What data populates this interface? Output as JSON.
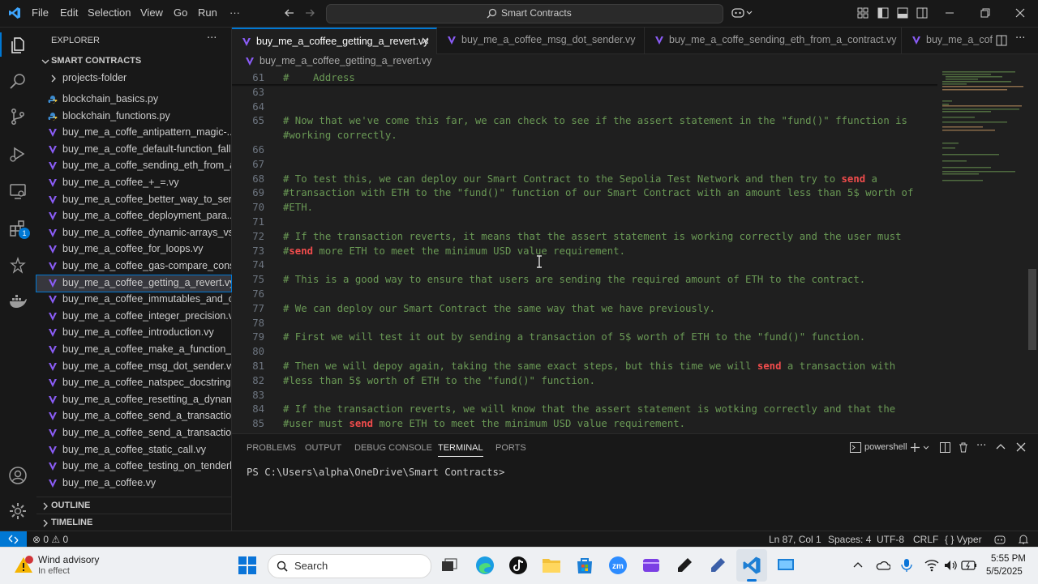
{
  "titlebar": {
    "menu": [
      "File",
      "Edit",
      "Selection",
      "View",
      "Go",
      "Run",
      "···"
    ],
    "search_text": "Smart Contracts"
  },
  "sidebar": {
    "title": "EXPLORER",
    "more": "···",
    "workspace": "SMART CONTRACTS",
    "folder": "projects-folder",
    "files": [
      "blockchain_basics.py",
      "blockchain_functions.py",
      "buy_me_a_coffe_antipattern_magic-...",
      "buy_me_a_coffe_default-function_fall...",
      "buy_me_a_coffe_sending_eth_from_a...",
      "buy_me_a_coffee_+_=.vy",
      "buy_me_a_coffee_better_way_to_sen...",
      "buy_me_a_coffee_deployment_para...",
      "buy_me_a_coffee_dynamic-arrays_vs...",
      "buy_me_a_coffee_for_loops.vy",
      "buy_me_a_coffee_gas-compare_cons...",
      "buy_me_a_coffee_getting_a_revert.vy",
      "buy_me_a_coffee_immutables_and_c...",
      "buy_me_a_coffee_integer_precision.vy",
      "buy_me_a_coffee_introduction.vy",
      "buy_me_a_coffee_make_a_function_c...",
      "buy_me_a_coffee_msg_dot_sender.vy",
      "buy_me_a_coffee_natspec_docstring...",
      "buy_me_a_coffee_resetting_a_dynam...",
      "buy_me_a_coffee_send_a_transaction...",
      "buy_me_a_coffee_send_a_transaction...",
      "buy_me_a_coffee_static_call.vy",
      "buy_me_a_coffee_testing_on_tenderl...",
      "buy_me_a_coffee.vy"
    ],
    "outline": "OUTLINE",
    "timeline": "TIMELINE",
    "extensions_badge": "1"
  },
  "tabs": [
    {
      "label": "buy_me_a_coffee_getting_a_revert.vy",
      "close": "✕"
    },
    {
      "label": "buy_me_a_coffee_msg_dot_sender.vy"
    },
    {
      "label": "buy_me_a_coffe_sending_eth_from_a_contract.vy"
    },
    {
      "label": "buy_me_a_coff"
    }
  ],
  "breadcrumb": "buy_me_a_coffee_getting_a_revert.vy",
  "editor": {
    "lines": [
      {
        "n": "61",
        "text": "#    Address"
      },
      {
        "n": "63",
        "text": ""
      },
      {
        "n": "64",
        "text": ""
      },
      {
        "n": "65",
        "text": "# Now that we've come this far, we can check to see if the assert statement in the \"fund()\" ffunction is"
      },
      {
        "n": "",
        "text": "#working correctly."
      },
      {
        "n": "66",
        "text": ""
      },
      {
        "n": "67",
        "text": ""
      },
      {
        "n": "68",
        "pre": "# To test this, we can deploy our Smart Contract to the Sepolia Test Network and then try to ",
        "kw": "send",
        "post": " a"
      },
      {
        "n": "69",
        "text": "#transaction with ETH to the \"fund()\" function of our Smart Contract with an amount less than 5$ worth of"
      },
      {
        "n": "70",
        "text": "#ETH."
      },
      {
        "n": "71",
        "text": ""
      },
      {
        "n": "72",
        "text": "# If the transaction reverts, it means that the assert statement is working correctly and the user must"
      },
      {
        "n": "73",
        "pre": "#",
        "kw": "send",
        "post": " more ETH to meet the minimum USD value requirement."
      },
      {
        "n": "74",
        "text": ""
      },
      {
        "n": "75",
        "text": "# This is a good way to ensure that users are sending the required amount of ETH to the contract."
      },
      {
        "n": "76",
        "text": ""
      },
      {
        "n": "77",
        "text": "# We can deploy our Smart Contract the same way that we have previously."
      },
      {
        "n": "78",
        "text": ""
      },
      {
        "n": "79",
        "text": "# First we will test it out by sending a transaction of 5$ worth of ETH to the \"fund()\" function."
      },
      {
        "n": "80",
        "text": ""
      },
      {
        "n": "81",
        "pre": "# Then we will depoy again, taking the same exact steps, but this time we will ",
        "kw": "send",
        "post": " a transaction with"
      },
      {
        "n": "82",
        "text": "#less than 5$ worth of ETH to the \"fund()\" function."
      },
      {
        "n": "83",
        "text": ""
      },
      {
        "n": "84",
        "text": "# If the transaction reverts, we will know that the assert statement is wotking correctly and that the"
      },
      {
        "n": "85",
        "pre": "#user must ",
        "kw": "send",
        "post": " more ETH to meet the minimum USD value requirement."
      },
      {
        "n": "86",
        "text": ""
      }
    ]
  },
  "panel": {
    "tabs": [
      "PROBLEMS",
      "OUTPUT",
      "DEBUG CONSOLE",
      "TERMINAL",
      "PORTS"
    ],
    "active_tab": "TERMINAL",
    "shell": "powershell",
    "prompt": "PS C:\\Users\\alpha\\OneDrive\\Smart Contracts>"
  },
  "statusbar": {
    "problems": "⊗ 0 ⚠ 0",
    "position": "Ln 87, Col 1",
    "spaces": "Spaces: 4",
    "encoding": "UTF-8",
    "eol": "CRLF",
    "language": "{ } Vyper"
  },
  "taskbar": {
    "weather_title": "Wind advisory",
    "weather_sub": "In effect",
    "search": "Search",
    "time": "5:55 PM",
    "date": "5/5/2025"
  },
  "colors": {
    "accent": "#0078d4",
    "comment": "#6a9955",
    "keyword": "#f14c4c",
    "vyper": "#8a5cf6"
  }
}
